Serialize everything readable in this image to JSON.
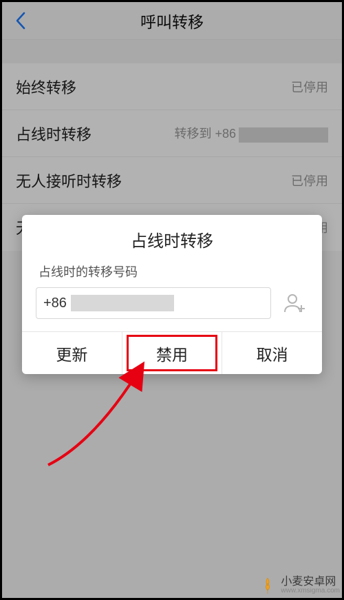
{
  "header": {
    "title": "呼叫转移"
  },
  "rows": [
    {
      "label": "始终转移",
      "status": "已停用"
    },
    {
      "label": "占线时转移",
      "status_prefix": "转移到 +86"
    },
    {
      "label": "无人接听时转移",
      "status": "已停用"
    },
    {
      "label_partial_left": "无",
      "status_partial_right": "用"
    }
  ],
  "dialog": {
    "title": "占线时转移",
    "subtitle": "占线时的转移号码",
    "input_prefix": "+86",
    "buttons": {
      "update": "更新",
      "disable": "禁用",
      "cancel": "取消"
    }
  },
  "watermark": {
    "brand": "小麦安卓网",
    "domain": "www.xmsigma.com"
  }
}
